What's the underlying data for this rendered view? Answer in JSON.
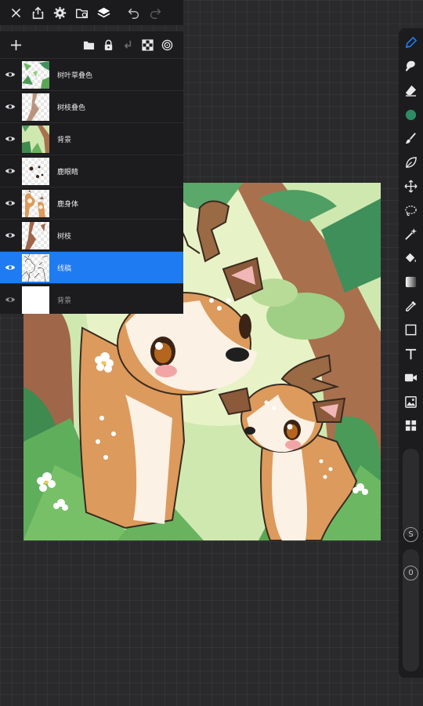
{
  "toolbar": {
    "icons": [
      "close-icon",
      "share-icon",
      "gear-icon",
      "gallery-import-icon",
      "layers-icon",
      "undo-icon",
      "redo-icon"
    ]
  },
  "layers_panel": {
    "header_icons": [
      "add-icon",
      "folder-icon",
      "lock-icon",
      "merge-down-icon",
      "checkerboard-icon",
      "target-icon"
    ],
    "layers": [
      {
        "name": "树叶草叠色",
        "visible": true,
        "active": false
      },
      {
        "name": "树枝叠色",
        "visible": true,
        "active": false
      },
      {
        "name": "背景",
        "visible": true,
        "active": false
      },
      {
        "name": "鹿眼睛",
        "visible": true,
        "active": false
      },
      {
        "name": "鹿身体",
        "visible": true,
        "active": false
      },
      {
        "name": "树枝",
        "visible": true,
        "active": false
      },
      {
        "name": "线稿",
        "visible": true,
        "active": true
      },
      {
        "name": "背景",
        "visible": true,
        "active": false,
        "dim": true
      }
    ]
  },
  "tool_rail": {
    "tools": [
      "pen-icon",
      "smudge-icon",
      "eraser-icon",
      "color-swatch",
      "brush-icon",
      "leaf-shape-icon",
      "move-icon",
      "lasso-icon",
      "magic-wand-icon",
      "fill-bucket-icon",
      "gradient-icon",
      "eyedropper-icon",
      "rectangle-icon",
      "text-icon",
      "video-icon",
      "image-icon",
      "grid-icon"
    ],
    "current_color": "#2e8b63",
    "size_slider_label": "S",
    "opacity_slider_label": "0"
  },
  "colors": {
    "accent": "#1e7bf2",
    "panel": "#1c1c1e",
    "background": "#2a2a2c"
  }
}
